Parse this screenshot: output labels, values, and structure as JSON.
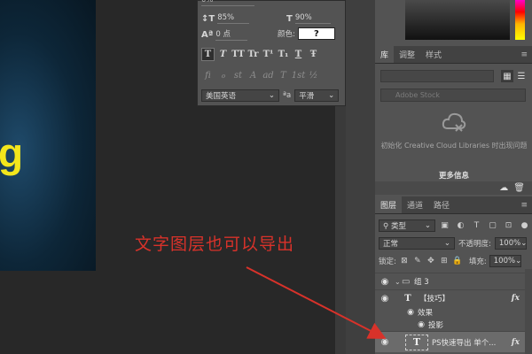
{
  "canvas": {
    "glyph": "g",
    "annotation": "文字图层也可以导出"
  },
  "character": {
    "vertical_scale": "85%",
    "horizontal_scale": "90%",
    "tracking": "0 点",
    "color_label": "颜色:",
    "color_value": "?",
    "style_buttons": [
      "T",
      "T",
      "TT",
      "Tr",
      "T¹",
      "T₁",
      "T",
      "Ŧ"
    ],
    "opentype_buttons": [
      "fi",
      "ℴ",
      "st",
      "A",
      "ad",
      "T",
      "1st",
      "½"
    ],
    "language": "美国英语",
    "aa_icon": "ªa",
    "antialias": "平滑"
  },
  "libraries": {
    "tabs": [
      "库",
      "调整",
      "样式"
    ],
    "search_placeholder": "Adobe Stock",
    "message": "初始化 Creative Cloud Libraries 时出现问题",
    "more_label": "更多信息"
  },
  "layers": {
    "tabs": [
      "图层",
      "通道",
      "路径"
    ],
    "filter_type": "类型",
    "blend_mode": "正常",
    "opacity_label": "不透明度:",
    "opacity_value": "100%",
    "lock_label": "锁定:",
    "fill_label": "填充:",
    "fill_value": "100%",
    "items": [
      {
        "name": "组 3",
        "kind": "group"
      },
      {
        "name": "【技巧】",
        "kind": "text",
        "fx": "fx"
      },
      {
        "name": "效果",
        "kind": "effects"
      },
      {
        "name": "投影",
        "kind": "effect"
      },
      {
        "name": "PS快速导出 单个...",
        "kind": "text-selected",
        "fx": "fx"
      }
    ]
  },
  "colors": {
    "annotation": "#d8322a",
    "glyph": "#f3e61c",
    "panel": "#535353"
  }
}
